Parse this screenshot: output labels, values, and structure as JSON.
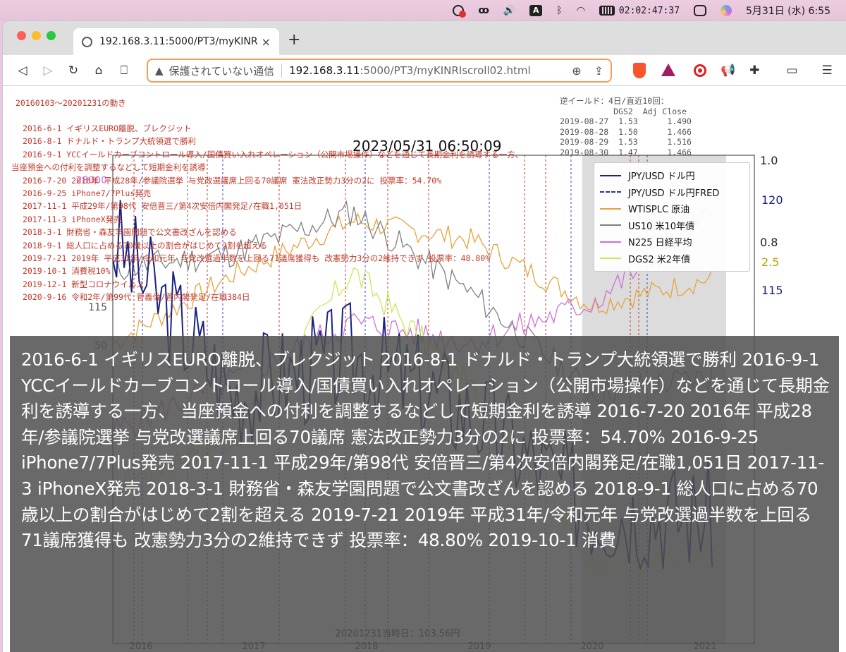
{
  "menubar": {
    "clock": "02:02:47:37",
    "date_time": "5月31日 (水)  6:55",
    "icons": [
      "fire-alert-icon",
      "glyph-icon",
      "volume-icon",
      "input-source-icon",
      "bluetooth-icon",
      "wifi-icon",
      "battery-icon",
      "control-center-icon",
      "siri-icon"
    ],
    "input_source_label": "A"
  },
  "browser": {
    "tab_title": "192.168.3.11:5000/PT3/myKINRI",
    "tab_close": "×",
    "new_tab": "+",
    "url_warning": "保護されていない通信",
    "url_host": "192.168.3.11",
    "url_rest": ":5000/PT3/myKINRIscroll02.html",
    "nav": {
      "back": "◁",
      "forward": "▷",
      "reload": "↻",
      "home": "⌂",
      "bookmark": "⎕"
    }
  },
  "page": {
    "period_title": "20160103～20201231の動き",
    "timestamp": "2023/05/31 06:50:09",
    "events": [
      "2016-6-1 イギリスEURO離脱、ブレクジット",
      "2016-8-1 ドナルド・トランプ大統領選で勝利",
      "2016-9-1 YCCイールドカーブコントロール導入/国債買い入れオペレーション（公開市場操作）などを通じて長期金利を誘導する一方、",
      "当座預金への付利を調整するなどして短期金利を誘導",
      "2016-7-20 2016年 平成28年/参議院選挙 与党改選議席上回る70議席  憲法改正勢力3分の2に 投票率：54.70%",
      "2016-9-25 iPhone7/7Plus発売",
      "2017-11-1 平成29年/第98代 安倍晋三/第4次安倍内閣発足/在職1,051日",
      "2017-11-3 iPhoneX発売",
      "2018-3-1 財務省・森友学園問題で公文書改ざんを認める",
      "2018-9-1 総人口に占める70歳以上の割合がはじめて2割を超える",
      "2019-7-21 2019年 平成31年/令和元年 与党改選過半数を上回る71議席獲得も 改憲勢力3分の2維持できず 投票率：48.80%",
      "2019-10-1 消費税10%",
      "2019-12-1 新型コロナウイルス",
      "2020-9-16 令和2年/第99代 菅義偉/菅内閣発足/在職384日"
    ],
    "inversion": {
      "title": "逆イールド：4日/直近10回：",
      "header": "           DGS2  Adj Close",
      "rows": [
        "2019-08-27  1.53      1.490",
        "2019-08-28  1.50      1.466",
        "2019-08-29  1.53      1.516",
        "2019-08-30  1.47      1.466"
      ]
    },
    "overlay_text": "2016-6-1 イギリスEURO離脱、ブレクジット 2016-8-1 ドナルド・トランプ大統領選で勝利 2016-9-1 YCCイールドカーブコントロール導入/国債買い入れオペレーション（公開市場操作）などを通じて長期金利を誘導する一方、 当座預金への付利を調整するなどして短期金利を誘導 2016-7-20 2016年 平成28年/参議院選挙 与党改選議席上回る70議席  憲法改正勢力3分の2に 投票率：54.70% 2016-9-25 iPhone7/7Plus発売 2017-11-1 平成29年/第98代 安倍晋三/第4次安倍内閣発足/在職1,051日 2017-11-3 iPhoneX発売 2018-3-1 財務省・森友学園問題で公文書改ざんを認める 2018-9-1 総人口に占める70歳以上の割合がはじめて2割を超える 2019-7-21 2019年 平成31年/令和元年 与党改選過半数を上回る71議席獲得も 改憲勢力3分の2維持できず 投票率：48.80% 2019-10-1 消費"
  },
  "chart_data": {
    "type": "line",
    "title": "2023/05/31 06:50:09",
    "x": [
      "2016",
      "2017",
      "2018",
      "2019",
      "2020",
      "2021"
    ],
    "series": [
      {
        "name": "JPY/USD ドル円",
        "color": "#1a237e",
        "style": "solid",
        "values": [
          118,
          110,
          112,
          109,
          104,
          103.56
        ]
      },
      {
        "name": "JPY/USD ドル円FRED",
        "color": "#283593",
        "style": "dashed",
        "values": []
      },
      {
        "name": "WTISPLC 原油",
        "color": "#e6a23c",
        "style": "solid",
        "values": [
          30,
          48,
          62,
          57,
          40,
          47
        ]
      },
      {
        "name": "US10 米10年債",
        "color": "#7f7f7f",
        "style": "solid",
        "values": [
          2.2,
          2.4,
          2.9,
          1.9,
          0.7,
          0.9
        ]
      },
      {
        "name": "N225 日経平均",
        "color": "#d070d8",
        "style": "solid",
        "values": [
          16500,
          19100,
          22000,
          21000,
          23000,
          27400
        ]
      },
      {
        "name": "DGS2 米2年債",
        "color": "#c8e858",
        "style": "solid",
        "values": [
          0.8,
          1.2,
          2.6,
          1.6,
          0.15,
          0.12
        ]
      }
    ],
    "right_axis_ticks": [
      "1.0",
      "0.8",
      "2.5",
      "115",
      "120"
    ],
    "left_axis_ticks": [
      "28000",
      "50",
      "115"
    ],
    "footer_visible": "20201231当時日：103.56円",
    "legend_position": "top-right",
    "grid": false
  }
}
